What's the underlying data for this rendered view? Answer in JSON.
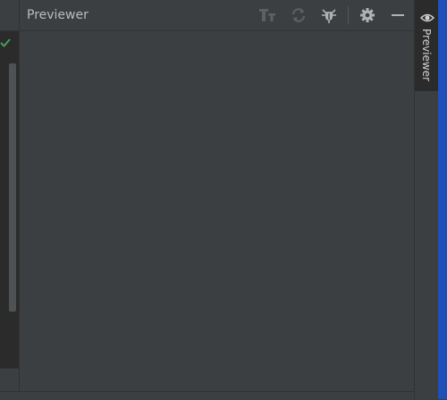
{
  "previewer": {
    "title": "Previewer",
    "toolbar": [
      {
        "name": "font-size-icon",
        "enabled": false
      },
      {
        "name": "refresh-icon",
        "enabled": false
      },
      {
        "name": "debug-icon",
        "enabled": true
      },
      {
        "name": "gear-icon",
        "enabled": true
      },
      {
        "name": "minimize-icon",
        "enabled": true
      }
    ]
  },
  "right_stripe": {
    "label": "Previewer",
    "icon": "eye-icon"
  },
  "editor": {
    "status_icon": "check-icon"
  },
  "colors": {
    "panel_bg": "#3c3f41",
    "editor_bg": "#2b2b2b",
    "text": "#bbbbbb",
    "icon_disabled": "#5d6062",
    "icon_enabled": "#afb1b3",
    "check": "#499c54",
    "accent_edge": "#1f4fb8"
  }
}
